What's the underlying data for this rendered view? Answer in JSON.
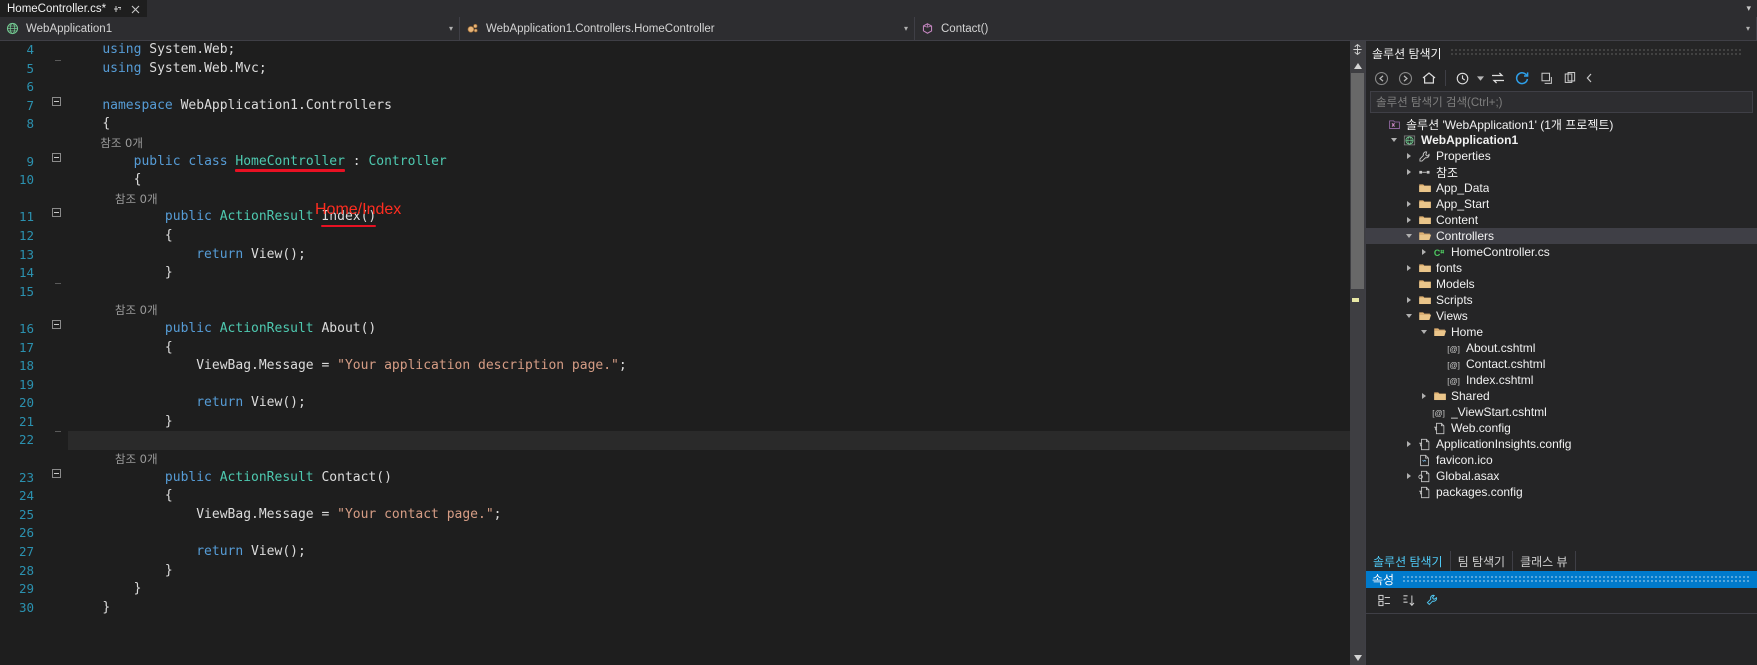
{
  "tab": {
    "label": "HomeController.cs*",
    "pin_icon": "pin-icon",
    "close_icon": "close-icon",
    "overflow_icon": "chevron-down-icon"
  },
  "navbar": {
    "project": {
      "text": "WebApplication1",
      "icon": "project-web-icon"
    },
    "type": {
      "text": "WebApplication1.Controllers.HomeController",
      "icon": "class-icon"
    },
    "member": {
      "text": "Contact()",
      "icon": "method-icon"
    },
    "caret": "▾"
  },
  "editor": {
    "lines": [
      {
        "num": "4",
        "gutter": "line",
        "indent": 1,
        "tokens": [
          {
            "c": "k",
            "t": "using"
          },
          {
            "c": "p",
            "t": " System.Web;"
          }
        ]
      },
      {
        "num": "5",
        "gutter": "line-end",
        "indent": 1,
        "tokens": [
          {
            "c": "k",
            "t": "using"
          },
          {
            "c": "p",
            "t": " System.Web.Mvc;"
          }
        ]
      },
      {
        "num": "6",
        "gutter": "none",
        "indent": 1,
        "tokens": []
      },
      {
        "num": "7",
        "gutter": "fold",
        "indent": 1,
        "tokens": [
          {
            "c": "k",
            "t": "namespace"
          },
          {
            "c": "p",
            "t": " WebApplication1.Controllers"
          }
        ]
      },
      {
        "num": "8",
        "gutter": "line",
        "indent": 1,
        "tokens": [
          {
            "c": "p",
            "t": "{"
          }
        ]
      },
      {
        "num": "",
        "gutter": "line",
        "indent": 2,
        "codelens": "참조 0개"
      },
      {
        "num": "9",
        "gutter": "fold",
        "indent": 2,
        "tokens": [
          {
            "c": "k",
            "t": "public"
          },
          {
            "c": "p",
            "t": " "
          },
          {
            "c": "k",
            "t": "class"
          },
          {
            "c": "p",
            "t": " "
          },
          {
            "c": "t",
            "t": "HomeController",
            "u": true
          },
          {
            "c": "p",
            "t": " : "
          },
          {
            "c": "t",
            "t": "Controller"
          }
        ]
      },
      {
        "num": "10",
        "gutter": "line",
        "indent": 2,
        "tokens": [
          {
            "c": "p",
            "t": "{"
          }
        ]
      },
      {
        "num": "",
        "gutter": "line",
        "indent": 3,
        "codelens": "참조 0개"
      },
      {
        "num": "11",
        "gutter": "fold",
        "indent": 3,
        "tokens": [
          {
            "c": "k",
            "t": "public"
          },
          {
            "c": "p",
            "t": " "
          },
          {
            "c": "t",
            "t": "ActionResult"
          },
          {
            "c": "p",
            "t": " "
          },
          {
            "c": "p",
            "t": "Index()",
            "u": true
          }
        ]
      },
      {
        "num": "12",
        "gutter": "line",
        "indent": 3,
        "tokens": [
          {
            "c": "p",
            "t": "{"
          }
        ]
      },
      {
        "num": "13",
        "gutter": "line",
        "indent": 4,
        "tokens": [
          {
            "c": "k",
            "t": "return"
          },
          {
            "c": "p",
            "t": " "
          },
          {
            "c": "p",
            "t": "View();"
          }
        ]
      },
      {
        "num": "14",
        "gutter": "line",
        "indent": 3,
        "tokens": [
          {
            "c": "p",
            "t": "}"
          }
        ]
      },
      {
        "num": "15",
        "gutter": "line-end",
        "indent": 3,
        "tokens": []
      },
      {
        "num": "",
        "gutter": "line",
        "indent": 3,
        "codelens": "참조 0개"
      },
      {
        "num": "16",
        "gutter": "fold",
        "indent": 3,
        "tokens": [
          {
            "c": "k",
            "t": "public"
          },
          {
            "c": "p",
            "t": " "
          },
          {
            "c": "t",
            "t": "ActionResult"
          },
          {
            "c": "p",
            "t": " About()"
          }
        ]
      },
      {
        "num": "17",
        "gutter": "line",
        "indent": 3,
        "tokens": [
          {
            "c": "p",
            "t": "{"
          }
        ]
      },
      {
        "num": "18",
        "gutter": "line",
        "indent": 4,
        "tokens": [
          {
            "c": "p",
            "t": "ViewBag.Message = "
          },
          {
            "c": "s",
            "t": "\"Your application description page.\""
          },
          {
            "c": "p",
            "t": ";"
          }
        ]
      },
      {
        "num": "19",
        "gutter": "line",
        "indent": 4,
        "tokens": []
      },
      {
        "num": "20",
        "gutter": "line",
        "indent": 4,
        "tokens": [
          {
            "c": "k",
            "t": "return"
          },
          {
            "c": "p",
            "t": " "
          },
          {
            "c": "p",
            "t": "View();"
          }
        ]
      },
      {
        "num": "21",
        "gutter": "line",
        "indent": 3,
        "tokens": [
          {
            "c": "p",
            "t": "}"
          }
        ]
      },
      {
        "num": "22",
        "gutter": "line-end",
        "indent": 3,
        "tokens": [],
        "highlight": true
      },
      {
        "num": "",
        "gutter": "line",
        "indent": 3,
        "codelens": "참조 0개"
      },
      {
        "num": "23",
        "gutter": "fold",
        "indent": 3,
        "tokens": [
          {
            "c": "k",
            "t": "public"
          },
          {
            "c": "p",
            "t": " "
          },
          {
            "c": "t",
            "t": "ActionResult"
          },
          {
            "c": "p",
            "t": " Contact()"
          }
        ]
      },
      {
        "num": "24",
        "gutter": "line",
        "indent": 3,
        "tokens": [
          {
            "c": "p",
            "t": "{"
          }
        ]
      },
      {
        "num": "25",
        "gutter": "line",
        "indent": 4,
        "modified": true,
        "tokens": [
          {
            "c": "p",
            "t": "ViewBag.Message = "
          },
          {
            "c": "s",
            "t": "\"Your contact page.\""
          },
          {
            "c": "p",
            "t": ";"
          }
        ]
      },
      {
        "num": "26",
        "gutter": "line",
        "indent": 4,
        "tokens": []
      },
      {
        "num": "27",
        "gutter": "line",
        "indent": 4,
        "tokens": [
          {
            "c": "k",
            "t": "return"
          },
          {
            "c": "p",
            "t": " "
          },
          {
            "c": "p",
            "t": "View();"
          }
        ]
      },
      {
        "num": "28",
        "gutter": "line",
        "indent": 3,
        "tokens": [
          {
            "c": "p",
            "t": "}"
          }
        ]
      },
      {
        "num": "29",
        "gutter": "line",
        "indent": 2,
        "tokens": [
          {
            "c": "p",
            "t": "}"
          }
        ]
      },
      {
        "num": "30",
        "gutter": "none",
        "indent": 1,
        "tokens": [
          {
            "c": "p",
            "t": "}"
          }
        ]
      }
    ],
    "annotation": {
      "text": "Home/Index",
      "color": "#ff2d20"
    }
  },
  "solution_explorer": {
    "title": "솔루션 탐색기",
    "search_placeholder": "솔루션 탐색기 검색(Ctrl+;)",
    "toolbar": [
      {
        "name": "back-icon",
        "glyph": "◄"
      },
      {
        "name": "forward-icon",
        "glyph": "►"
      },
      {
        "name": "home-icon",
        "glyph": "⌂"
      },
      {
        "name": "pending-changes-icon",
        "glyph": "◔"
      },
      {
        "name": "chevron-down-icon",
        "glyph": "▾"
      },
      {
        "name": "sync-with-active-document-icon",
        "glyph": "⇄"
      },
      {
        "name": "refresh-icon",
        "glyph": "⟳"
      },
      {
        "name": "collapse-all-icon",
        "glyph": "⊟"
      },
      {
        "name": "show-all-files-icon",
        "glyph": "❐"
      },
      {
        "name": "properties-icon",
        "glyph": "◂"
      }
    ],
    "tree": [
      {
        "label": "솔루션 'WebApplication1' (1개 프로젝트)",
        "depth": 0,
        "expander": "none",
        "icon": "solution-icon",
        "bold": false
      },
      {
        "label": "WebApplication1",
        "depth": 1,
        "expander": "open",
        "icon": "web-project-icon",
        "bold": true
      },
      {
        "label": "Properties",
        "depth": 2,
        "expander": "closed",
        "icon": "wrench-icon",
        "bold": false
      },
      {
        "label": "참조",
        "depth": 2,
        "expander": "closed",
        "icon": "references-icon",
        "bold": false
      },
      {
        "label": "App_Data",
        "depth": 2,
        "expander": "none",
        "icon": "folder-icon",
        "bold": false
      },
      {
        "label": "App_Start",
        "depth": 2,
        "expander": "closed",
        "icon": "folder-icon",
        "bold": false
      },
      {
        "label": "Content",
        "depth": 2,
        "expander": "closed",
        "icon": "folder-icon",
        "bold": false
      },
      {
        "label": "Controllers",
        "depth": 2,
        "expander": "open",
        "icon": "folder-open-icon",
        "bold": false,
        "selected": true
      },
      {
        "label": "HomeController.cs",
        "depth": 3,
        "expander": "closed",
        "icon": "csharp-file-icon",
        "bold": false,
        "underline": true
      },
      {
        "label": "fonts",
        "depth": 2,
        "expander": "closed",
        "icon": "folder-icon",
        "bold": false
      },
      {
        "label": "Models",
        "depth": 2,
        "expander": "none",
        "icon": "folder-icon",
        "bold": false
      },
      {
        "label": "Scripts",
        "depth": 2,
        "expander": "closed",
        "icon": "folder-icon",
        "bold": false
      },
      {
        "label": "Views",
        "depth": 2,
        "expander": "open",
        "icon": "folder-open-icon",
        "bold": false
      },
      {
        "label": "Home",
        "depth": 3,
        "expander": "open",
        "icon": "folder-open-icon",
        "bold": false,
        "underline": true
      },
      {
        "label": "About.cshtml",
        "depth": 4,
        "expander": "none",
        "icon": "cshtml-file-icon",
        "bold": false
      },
      {
        "label": "Contact.cshtml",
        "depth": 4,
        "expander": "none",
        "icon": "cshtml-file-icon",
        "bold": false
      },
      {
        "label": "Index.cshtml",
        "depth": 4,
        "expander": "none",
        "icon": "cshtml-file-icon",
        "bold": false,
        "underline": true
      },
      {
        "label": "Shared",
        "depth": 3,
        "expander": "closed",
        "icon": "folder-icon",
        "bold": false
      },
      {
        "label": "_ViewStart.cshtml",
        "depth": 3,
        "expander": "none",
        "icon": "cshtml-file-icon",
        "bold": false
      },
      {
        "label": "Web.config",
        "depth": 3,
        "expander": "none",
        "icon": "config-file-icon",
        "bold": false
      },
      {
        "label": "ApplicationInsights.config",
        "depth": 2,
        "expander": "closed",
        "icon": "config-file-icon",
        "bold": false
      },
      {
        "label": "favicon.ico",
        "depth": 2,
        "expander": "none",
        "icon": "ico-file-icon",
        "bold": false
      },
      {
        "label": "Global.asax",
        "depth": 2,
        "expander": "closed",
        "icon": "asax-file-icon",
        "bold": false
      },
      {
        "label": "packages.config",
        "depth": 2,
        "expander": "none",
        "icon": "config-file-icon",
        "bold": false
      }
    ],
    "dock_tabs": [
      {
        "label": "솔루션 탐색기",
        "active": true
      },
      {
        "label": "팀 탐색기",
        "active": false
      },
      {
        "label": "클래스 뷰",
        "active": false
      }
    ]
  },
  "properties_pane": {
    "title": "속성",
    "toolbar": [
      {
        "name": "categorized-icon",
        "glyph": "▦"
      },
      {
        "name": "alphabetical-icon",
        "glyph": "↓"
      },
      {
        "name": "property-pages-icon",
        "glyph": "🔧"
      }
    ]
  },
  "colors": {
    "accent": "#007acc",
    "annotation_red": "#e81123",
    "modified_marker": "#e8e8a6",
    "editor_bg": "#1e1e1e",
    "panel_bg": "#252526"
  }
}
